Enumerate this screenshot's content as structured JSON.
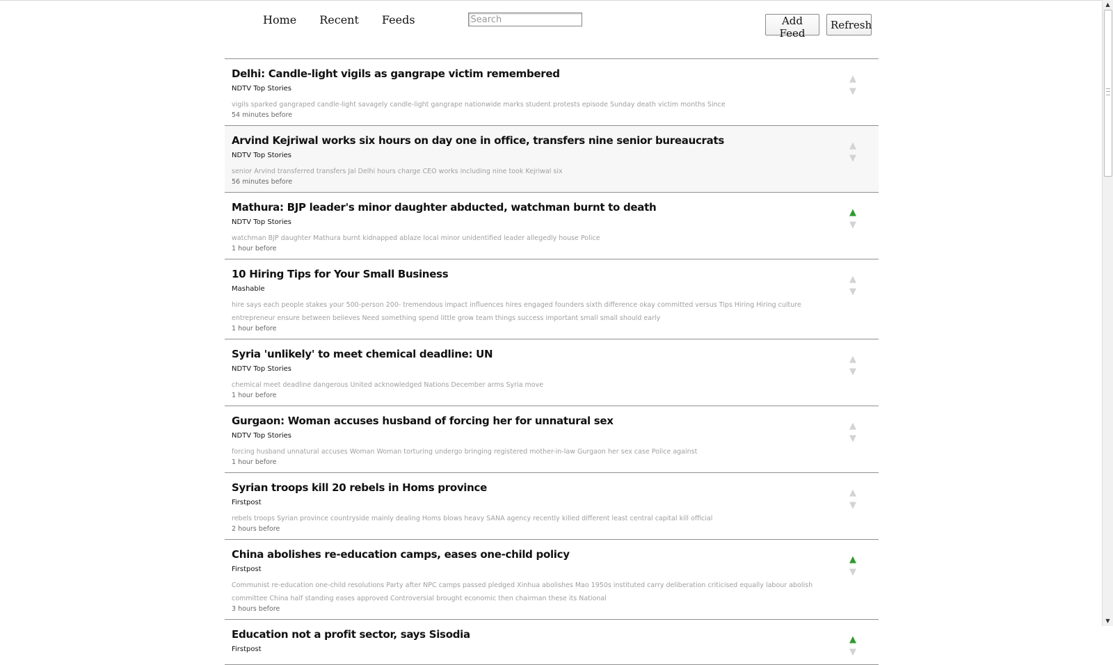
{
  "nav": {
    "home": "Home",
    "recent": "Recent",
    "feeds": "Feeds",
    "search_placeholder": "Search"
  },
  "toolbar": {
    "add_feed": "Add Feed",
    "refresh": "Refresh"
  },
  "vote_icons": {
    "up": "▲",
    "down": "▼"
  },
  "colors": {
    "upvoted": "#2f9a2f",
    "vote_neutral": "#d3d3d3",
    "keywords": "#a0a0a0"
  },
  "items": [
    {
      "title": "Delhi: Candle-light vigils as gangrape victim remembered",
      "source": "NDTV Top Stories",
      "keywords": "vigils sparked gangraped candle-light savagely candle-light gangrape nationwide marks student protests episode Sunday death victim months Since",
      "time": "54 minutes before",
      "vote": "none"
    },
    {
      "title": "Arvind Kejriwal works six hours on day one in office, transfers nine senior bureaucrats",
      "source": "NDTV Top Stories",
      "keywords": "senior Arvind transferred transfers Jal Delhi hours charge CEO works including nine took Kejriwal six",
      "time": "56 minutes before",
      "vote": "none"
    },
    {
      "title": "Mathura: BJP leader's minor daughter abducted, watchman burnt to death",
      "source": "NDTV Top Stories",
      "keywords": "watchman BJP daughter Mathura burnt kidnapped ablaze local minor unidentified leader allegedly house Police",
      "time": "1 hour before",
      "vote": "up"
    },
    {
      "title": "10 Hiring Tips for Your Small Business",
      "source": "Mashable",
      "keywords": "hire says each people stakes your 500-person 200- tremendous impact influences hires engaged founders sixth difference okay committed versus Tips Hiring Hiring culture entrepreneur ensure between believes Need something spend little grow team things success important small small should early",
      "time": "1 hour before",
      "vote": "none"
    },
    {
      "title": "Syria 'unlikely' to meet chemical deadline: UN",
      "source": "NDTV Top Stories",
      "keywords": "chemical meet deadline dangerous United acknowledged Nations December arms Syria move",
      "time": "1 hour before",
      "vote": "none"
    },
    {
      "title": "Gurgaon: Woman accuses husband of forcing her for unnatural sex",
      "source": "NDTV Top Stories",
      "keywords": "forcing husband unnatural accuses Woman Woman torturing undergo bringing registered mother-in-law Gurgaon her sex case Police against",
      "time": "1 hour before",
      "vote": "none"
    },
    {
      "title": "Syrian troops kill 20 rebels in Homs province",
      "source": "Firstpost",
      "keywords": "rebels troops Syrian province countryside mainly dealing Homs blows heavy SANA agency recently killed different least central capital kill official",
      "time": "2 hours before",
      "vote": "none"
    },
    {
      "title": "China abolishes re-education camps, eases one-child policy",
      "source": "Firstpost",
      "keywords": "Communist re-education one-child resolutions Party after NPC camps passed pledged Xinhua abolishes Mao 1950s instituted carry deliberation criticised equally labour abolish committee China half standing eases approved Controversial brought economic then chairman these its National",
      "time": "3 hours before",
      "vote": "up"
    },
    {
      "title": "Education not a profit sector, says Sisodia",
      "source": "Firstpost",
      "keywords": "",
      "time": "",
      "vote": "up"
    }
  ]
}
